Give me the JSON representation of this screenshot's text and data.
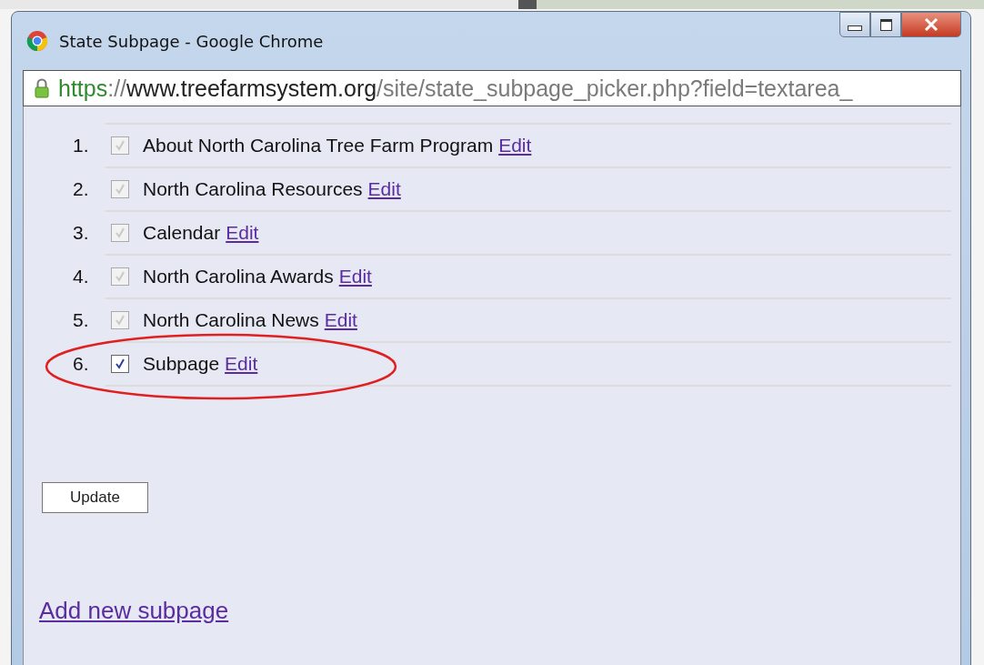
{
  "window": {
    "title": "State Subpage - Google Chrome"
  },
  "address_bar": {
    "scheme": "https",
    "separator": "://",
    "host": "www.treefarmsystem.org",
    "path": "/site/state_subpage_picker.php?field=textarea_"
  },
  "subpages": [
    {
      "number": "1.",
      "title": "About North Carolina Tree Farm Program",
      "link": "Edit",
      "checked": true,
      "disabled": true,
      "highlighted": false
    },
    {
      "number": "2.",
      "title": "North Carolina Resources",
      "link": "Edit",
      "checked": true,
      "disabled": true,
      "highlighted": false
    },
    {
      "number": "3.",
      "title": "Calendar",
      "link": "Edit",
      "checked": true,
      "disabled": true,
      "highlighted": false
    },
    {
      "number": "4.",
      "title": "North Carolina Awards",
      "link": "Edit",
      "checked": true,
      "disabled": true,
      "highlighted": false
    },
    {
      "number": "5.",
      "title": "North Carolina News",
      "link": "Edit",
      "checked": true,
      "disabled": true,
      "highlighted": false
    },
    {
      "number": "6.",
      "title": "Subpage",
      "link": "Edit",
      "checked": true,
      "disabled": false,
      "highlighted": true
    }
  ],
  "update_button": "Update",
  "add_link": "Add new subpage"
}
